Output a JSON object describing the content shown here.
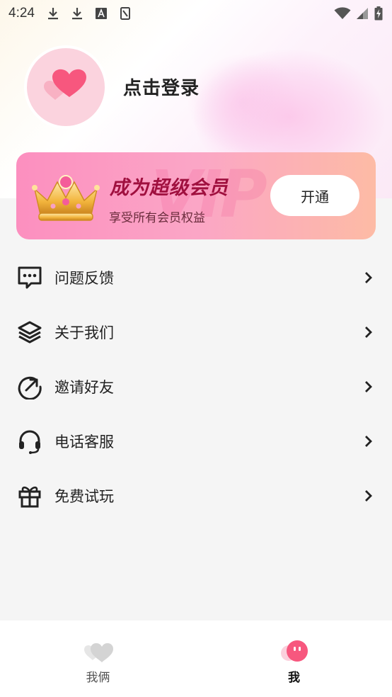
{
  "status_bar": {
    "time": "4:24",
    "left_icons": [
      "download-icon",
      "download-icon",
      "text-a-icon",
      "sim-icon"
    ],
    "right_icons": [
      "wifi-icon",
      "signal-icon",
      "battery-charging-icon"
    ]
  },
  "profile": {
    "avatar_icon": "heart-icon",
    "login_label": "点击登录"
  },
  "vip": {
    "watermark": "VIP",
    "title": "成为超级会员",
    "subtitle": "享受所有会员权益",
    "button_label": "开通",
    "icon": "crown-icon"
  },
  "menu": {
    "items": [
      {
        "label": "问题反馈",
        "icon": "chat-icon"
      },
      {
        "label": "关于我们",
        "icon": "layers-icon"
      },
      {
        "label": "邀请好友",
        "icon": "share-arrow-icon"
      },
      {
        "label": "电话客服",
        "icon": "headset-icon"
      },
      {
        "label": "免费试玩",
        "icon": "gift-icon"
      }
    ]
  },
  "bottom_nav": {
    "tabs": [
      {
        "label": "我俩",
        "icon": "hearts-icon",
        "active": false
      },
      {
        "label": "我",
        "icon": "face-icon",
        "active": true
      }
    ]
  },
  "colors": {
    "accent": "#f7577e",
    "vip_title": "#a0103f",
    "banner_start": "#fc8fbf",
    "banner_end": "#fdbba5"
  }
}
